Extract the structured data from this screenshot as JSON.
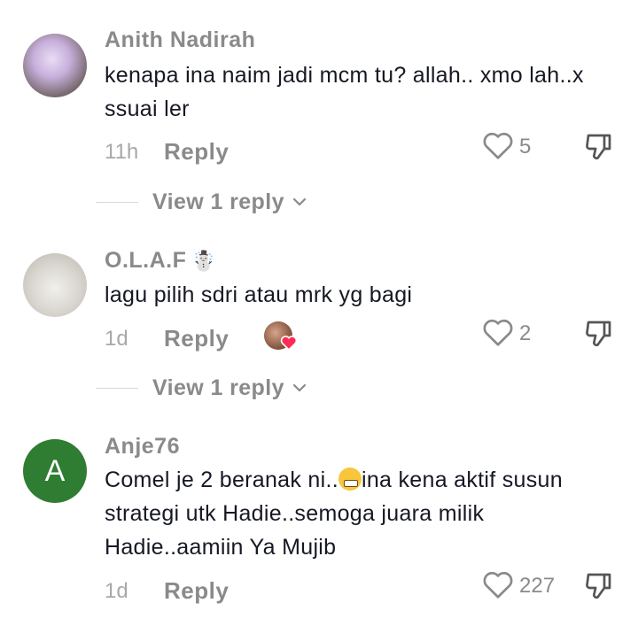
{
  "comments": [
    {
      "username": "Anith Nadirah",
      "text": "kenapa ina naim jadi mcm tu? allah.. xmo lah..x ssuai ler",
      "time": "11h",
      "reply_label": "Reply",
      "likes": "5",
      "view_replies_label": "View 1 reply"
    },
    {
      "username": "O.L.A.F",
      "username_emoji": "☃️",
      "text": "lagu pilih sdri atau mrk yg bagi",
      "time": "1d",
      "reply_label": "Reply",
      "likes": "2",
      "view_replies_label": "View 1 reply"
    },
    {
      "username": "Anje76",
      "avatar_initial": "A",
      "text_before_emoji": "Comel je 2 beranak ni..",
      "text_after_emoji": "ina kena aktif susun strategi utk Hadie..semoga juara milik Hadie..aamiin Ya Mujib",
      "time": "1d",
      "reply_label": "Reply",
      "likes": "227"
    }
  ],
  "colors": {
    "username": "#8a8a8a",
    "body_text": "#161823",
    "meta": "#a8a8a8",
    "avatar_initial_bg": "#2e7d32",
    "liked_heart": "#fe2c55"
  }
}
